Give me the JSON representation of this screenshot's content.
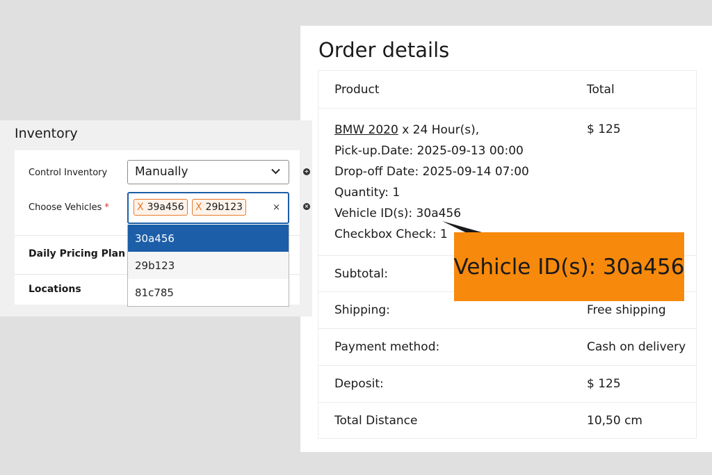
{
  "inventory": {
    "title": "Inventory",
    "control_label": "Control Inventory",
    "control_value": "Manually",
    "choose_label": "Choose Vehicles",
    "required_mark": "*",
    "tags": [
      "39a456",
      "29b123"
    ],
    "tag_remove_glyph": "X",
    "clear_glyph": "×",
    "dropdown_options": [
      "30a456",
      "29b123",
      "81c785"
    ],
    "selected_option": "30a456",
    "daily_pricing_label": "Daily Pricing Plan",
    "locations_label": "Locations",
    "accent_color": "#1c5ea8",
    "tag_color": "#e8792a"
  },
  "order": {
    "title": "Order details",
    "header": {
      "product": "Product",
      "total": "Total"
    },
    "product": {
      "name": "BMW 2020",
      "duration": " x 24 Hour(s),",
      "pickup": "Pick-up.Date: 2025-09-13 00:00",
      "dropoff": "Drop-off Date: 2025-09-14 07:00",
      "quantity": "Quantity: 1",
      "vehicle_ids": "Vehicle ID(s): 30a456",
      "checkbox": "Checkbox Check: 1",
      "total": "$ 125"
    },
    "rows": [
      {
        "label": "Subtotal:",
        "value": ""
      },
      {
        "label": "Shipping:",
        "value": "Free shipping"
      },
      {
        "label": "Payment method:",
        "value": "Cash on delivery"
      },
      {
        "label": "Deposit:",
        "value": "$ 125"
      },
      {
        "label": "Total Distance",
        "value": "10,50 cm"
      }
    ]
  },
  "callout": {
    "text": "Vehicle ID(s): 30a456",
    "color": "#f7890c"
  }
}
